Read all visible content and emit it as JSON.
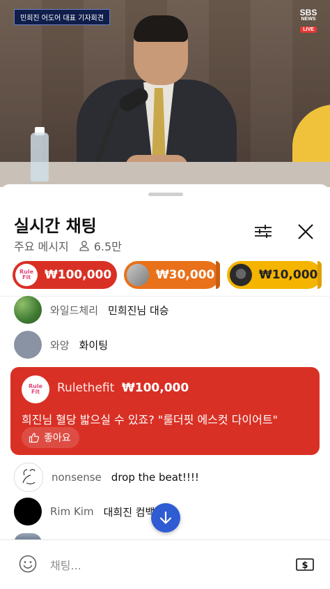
{
  "video": {
    "news_badge": "민희진 어도어 대표 기자회견",
    "broadcaster": {
      "line1": "SBS",
      "line2": "NEWS",
      "live": "LIVE"
    }
  },
  "chat": {
    "title": "실시간 채팅",
    "mode": "주요 메시지",
    "viewers": "6.5만",
    "icons": {
      "filter": "tune-icon",
      "close": "close-icon",
      "viewers": "person-icon"
    }
  },
  "tickers": [
    {
      "amount": "₩100,000",
      "color": "#d93025",
      "avatar": "rulefit-logo"
    },
    {
      "amount": "₩30,000",
      "color": "#e8711a",
      "avatar": "user-avatar"
    },
    {
      "amount": "₩10,000",
      "color": "#f4b400",
      "avatar": "user-avatar"
    }
  ],
  "rulefit_logo": {
    "line1": "Rule",
    "line2": "Fit"
  },
  "messages": [
    {
      "author": "와일드체리",
      "text": "민희진님 대승"
    },
    {
      "author": "와앙",
      "text": "화이팅"
    }
  ],
  "superchat": {
    "author": "Rulethefit",
    "amount": "₩100,000",
    "text": "희진님 혈당 밟으실 수 있죠? \"룰더핏 에스컷 다이어트\"",
    "like_label": "좋아요",
    "color": "#d93025"
  },
  "messages_after": [
    {
      "author": "nonsense",
      "text": "drop the beat!!!!"
    },
    {
      "author": "Rim Kim",
      "text": "대희진 컴백"
    }
  ],
  "input": {
    "placeholder": "채팅..."
  }
}
